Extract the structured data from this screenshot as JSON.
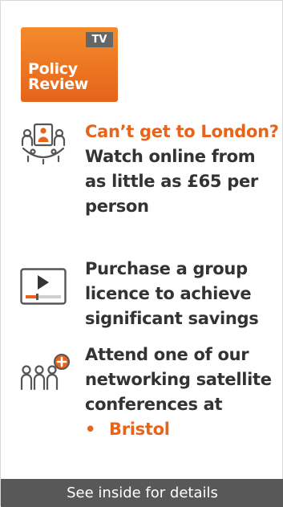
{
  "logo": {
    "badge": "TV",
    "line1": "Policy",
    "line2": "Review"
  },
  "features": [
    {
      "icon": "video-conference-icon",
      "highlight": "Can’t get to London?",
      "lines": [
        "Watch online from",
        "as little as £65 per",
        "person"
      ]
    },
    {
      "icon": "video-player-icon",
      "lines": [
        "Purchase a group",
        "licence to achieve",
        "significant savings"
      ]
    },
    {
      "icon": "add-people-group-icon",
      "lines": [
        "Attend one of our",
        "networking satellite",
        "conferences at"
      ],
      "bullet": "•",
      "bullet_item": "Bristol"
    }
  ],
  "footer": {
    "label": "See inside for details"
  },
  "colors": {
    "accent": "#e8641b",
    "text": "#333333",
    "footer_bg": "#585858"
  }
}
